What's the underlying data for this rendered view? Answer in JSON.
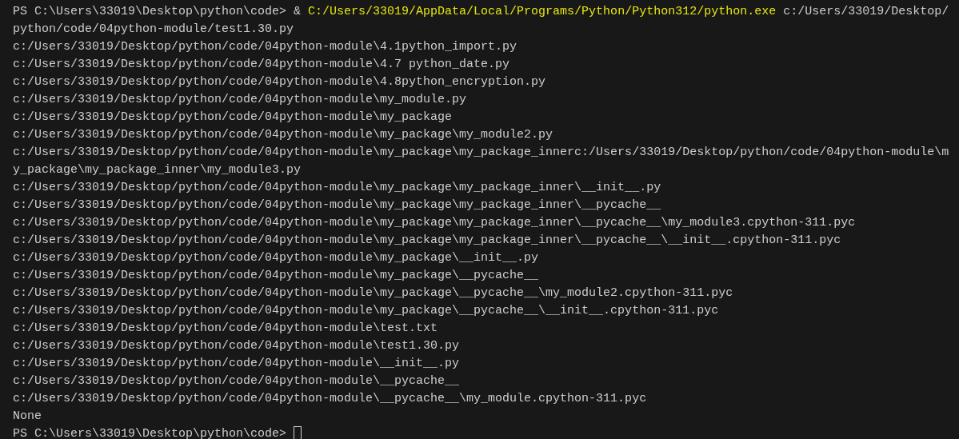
{
  "terminal": {
    "rows": [
      {
        "segments": [
          {
            "kind": "plain",
            "text": "PS C:\\Users\\33019\\Desktop\\python\\code> & "
          },
          {
            "kind": "command",
            "text": "C:/Users/33019/AppData/Local/Programs/Python/Python312/python.exe"
          },
          {
            "kind": "plain",
            "text": " c:/Users/33019/Desktop/"
          }
        ]
      },
      {
        "segments": [
          {
            "kind": "plain",
            "text": "python/code/04python-module/test1.30.py"
          }
        ]
      },
      {
        "segments": [
          {
            "kind": "plain",
            "text": "c:/Users/33019/Desktop/python/code/04python-module\\4.1python_import.py"
          }
        ]
      },
      {
        "segments": [
          {
            "kind": "plain",
            "text": "c:/Users/33019/Desktop/python/code/04python-module\\4.7 python_date.py"
          }
        ]
      },
      {
        "segments": [
          {
            "kind": "plain",
            "text": "c:/Users/33019/Desktop/python/code/04python-module\\4.8python_encryption.py"
          }
        ]
      },
      {
        "segments": [
          {
            "kind": "plain",
            "text": "c:/Users/33019/Desktop/python/code/04python-module\\my_module.py"
          }
        ]
      },
      {
        "segments": [
          {
            "kind": "plain",
            "text": "c:/Users/33019/Desktop/python/code/04python-module\\my_package"
          }
        ]
      },
      {
        "segments": [
          {
            "kind": "plain",
            "text": "c:/Users/33019/Desktop/python/code/04python-module\\my_package\\my_module2.py"
          }
        ]
      },
      {
        "segments": [
          {
            "kind": "plain",
            "text": "c:/Users/33019/Desktop/python/code/04python-module\\my_package\\my_package_innerc:/Users/33019/Desktop/python/code/04python-module\\m"
          }
        ]
      },
      {
        "segments": [
          {
            "kind": "plain",
            "text": "y_package\\my_package_inner\\my_module3.py"
          }
        ]
      },
      {
        "segments": [
          {
            "kind": "plain",
            "text": "c:/Users/33019/Desktop/python/code/04python-module\\my_package\\my_package_inner\\__init__.py"
          }
        ]
      },
      {
        "segments": [
          {
            "kind": "plain",
            "text": "c:/Users/33019/Desktop/python/code/04python-module\\my_package\\my_package_inner\\__pycache__"
          }
        ]
      },
      {
        "segments": [
          {
            "kind": "plain",
            "text": "c:/Users/33019/Desktop/python/code/04python-module\\my_package\\my_package_inner\\__pycache__\\my_module3.cpython-311.pyc"
          }
        ]
      },
      {
        "segments": [
          {
            "kind": "plain",
            "text": "c:/Users/33019/Desktop/python/code/04python-module\\my_package\\my_package_inner\\__pycache__\\__init__.cpython-311.pyc"
          }
        ]
      },
      {
        "segments": [
          {
            "kind": "plain",
            "text": "c:/Users/33019/Desktop/python/code/04python-module\\my_package\\__init__.py"
          }
        ]
      },
      {
        "segments": [
          {
            "kind": "plain",
            "text": "c:/Users/33019/Desktop/python/code/04python-module\\my_package\\__pycache__"
          }
        ]
      },
      {
        "segments": [
          {
            "kind": "plain",
            "text": "c:/Users/33019/Desktop/python/code/04python-module\\my_package\\__pycache__\\my_module2.cpython-311.pyc"
          }
        ]
      },
      {
        "segments": [
          {
            "kind": "plain",
            "text": "c:/Users/33019/Desktop/python/code/04python-module\\my_package\\__pycache__\\__init__.cpython-311.pyc"
          }
        ]
      },
      {
        "segments": [
          {
            "kind": "plain",
            "text": "c:/Users/33019/Desktop/python/code/04python-module\\test.txt"
          }
        ]
      },
      {
        "segments": [
          {
            "kind": "plain",
            "text": "c:/Users/33019/Desktop/python/code/04python-module\\test1.30.py"
          }
        ]
      },
      {
        "segments": [
          {
            "kind": "plain",
            "text": "c:/Users/33019/Desktop/python/code/04python-module\\__init__.py"
          }
        ]
      },
      {
        "segments": [
          {
            "kind": "plain",
            "text": "c:/Users/33019/Desktop/python/code/04python-module\\__pycache__"
          }
        ]
      },
      {
        "segments": [
          {
            "kind": "plain",
            "text": "c:/Users/33019/Desktop/python/code/04python-module\\__pycache__\\my_module.cpython-311.pyc"
          }
        ]
      },
      {
        "segments": [
          {
            "kind": "plain",
            "text": "None"
          }
        ]
      },
      {
        "segments": [
          {
            "kind": "plain",
            "text": "PS C:\\Users\\33019\\Desktop\\python\\code> "
          }
        ],
        "cursor": true
      }
    ]
  }
}
